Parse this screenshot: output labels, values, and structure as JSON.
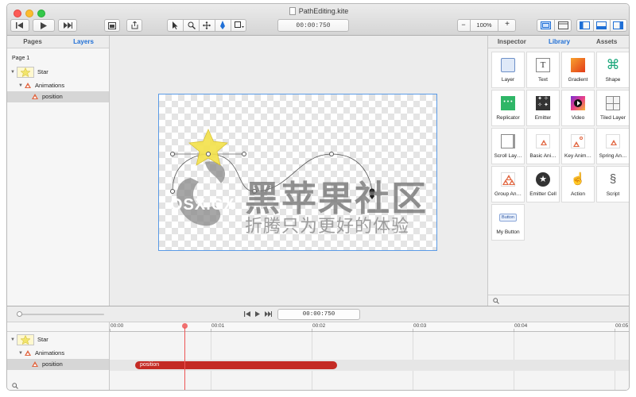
{
  "window": {
    "title": "PathEditing.kite"
  },
  "toolbar": {
    "time_display": "00:00:750",
    "zoom_value": "100%",
    "zoom_minus": "−",
    "zoom_plus": "+"
  },
  "left_panel": {
    "tabs": [
      {
        "label": "Pages"
      },
      {
        "label": "Layers"
      }
    ],
    "page_label": "Page 1",
    "tree": [
      {
        "label": "Star"
      },
      {
        "label": "Animations"
      },
      {
        "label": "position"
      }
    ]
  },
  "right_panel": {
    "tabs": [
      {
        "label": "Inspector"
      },
      {
        "label": "Library"
      },
      {
        "label": "Assets"
      }
    ],
    "library": [
      {
        "label": "Layer",
        "icon": "layer-icon"
      },
      {
        "label": "Text",
        "icon": "text-icon"
      },
      {
        "label": "Gradient",
        "icon": "gradient-icon"
      },
      {
        "label": "Shape",
        "icon": "shape-icon"
      },
      {
        "label": "Replicator",
        "icon": "replicator-icon"
      },
      {
        "label": "Emitter",
        "icon": "emitter-icon"
      },
      {
        "label": "Video",
        "icon": "video-icon"
      },
      {
        "label": "Tiled Layer",
        "icon": "tiled-layer-icon"
      },
      {
        "label": "Scroll Lay…",
        "icon": "scroll-layer-icon"
      },
      {
        "label": "Basic Ani…",
        "icon": "basic-animation-icon"
      },
      {
        "label": "Key Anim…",
        "icon": "keyframe-animation-icon"
      },
      {
        "label": "Spring An…",
        "icon": "spring-animation-icon"
      },
      {
        "label": "Group An…",
        "icon": "group-animation-icon"
      },
      {
        "label": "Emitter Cell",
        "icon": "emitter-cell-icon"
      },
      {
        "label": "Action",
        "icon": "action-icon"
      },
      {
        "label": "Script",
        "icon": "script-icon"
      },
      {
        "label": "My Button",
        "icon": "my-button-icon",
        "icon_text": "Button"
      }
    ]
  },
  "watermark": {
    "title": "黑苹果社区",
    "subtitle": "折腾只为更好的体验",
    "domain": "OSX.CX"
  },
  "timeline": {
    "time_display": "00:00:750",
    "ruler": [
      "00:00",
      "00:01",
      "00:02",
      "00:03",
      "00:04",
      "00:05"
    ],
    "tree": [
      {
        "label": "Star"
      },
      {
        "label": "Animations"
      },
      {
        "label": "position"
      }
    ],
    "track_label": "position"
  },
  "colors": {
    "accent": "#1f6fd6",
    "track": "#c42a24",
    "selection": "#5b9be6"
  }
}
